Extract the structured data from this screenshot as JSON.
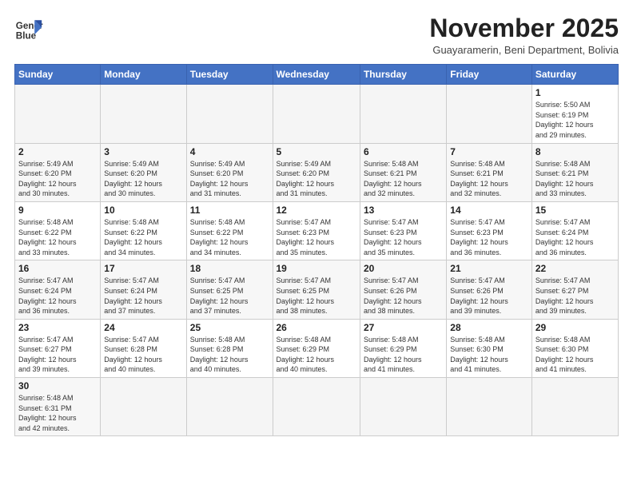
{
  "logo": {
    "line1": "General",
    "line2": "Blue"
  },
  "title": "November 2025",
  "subtitle": "Guayaramerin, Beni Department, Bolivia",
  "headers": [
    "Sunday",
    "Monday",
    "Tuesday",
    "Wednesday",
    "Thursday",
    "Friday",
    "Saturday"
  ],
  "weeks": [
    [
      {
        "day": "",
        "info": ""
      },
      {
        "day": "",
        "info": ""
      },
      {
        "day": "",
        "info": ""
      },
      {
        "day": "",
        "info": ""
      },
      {
        "day": "",
        "info": ""
      },
      {
        "day": "",
        "info": ""
      },
      {
        "day": "1",
        "info": "Sunrise: 5:50 AM\nSunset: 6:19 PM\nDaylight: 12 hours\nand 29 minutes."
      }
    ],
    [
      {
        "day": "2",
        "info": "Sunrise: 5:49 AM\nSunset: 6:20 PM\nDaylight: 12 hours\nand 30 minutes."
      },
      {
        "day": "3",
        "info": "Sunrise: 5:49 AM\nSunset: 6:20 PM\nDaylight: 12 hours\nand 30 minutes."
      },
      {
        "day": "4",
        "info": "Sunrise: 5:49 AM\nSunset: 6:20 PM\nDaylight: 12 hours\nand 31 minutes."
      },
      {
        "day": "5",
        "info": "Sunrise: 5:49 AM\nSunset: 6:20 PM\nDaylight: 12 hours\nand 31 minutes."
      },
      {
        "day": "6",
        "info": "Sunrise: 5:48 AM\nSunset: 6:21 PM\nDaylight: 12 hours\nand 32 minutes."
      },
      {
        "day": "7",
        "info": "Sunrise: 5:48 AM\nSunset: 6:21 PM\nDaylight: 12 hours\nand 32 minutes."
      },
      {
        "day": "8",
        "info": "Sunrise: 5:48 AM\nSunset: 6:21 PM\nDaylight: 12 hours\nand 33 minutes."
      }
    ],
    [
      {
        "day": "9",
        "info": "Sunrise: 5:48 AM\nSunset: 6:22 PM\nDaylight: 12 hours\nand 33 minutes."
      },
      {
        "day": "10",
        "info": "Sunrise: 5:48 AM\nSunset: 6:22 PM\nDaylight: 12 hours\nand 34 minutes."
      },
      {
        "day": "11",
        "info": "Sunrise: 5:48 AM\nSunset: 6:22 PM\nDaylight: 12 hours\nand 34 minutes."
      },
      {
        "day": "12",
        "info": "Sunrise: 5:47 AM\nSunset: 6:23 PM\nDaylight: 12 hours\nand 35 minutes."
      },
      {
        "day": "13",
        "info": "Sunrise: 5:47 AM\nSunset: 6:23 PM\nDaylight: 12 hours\nand 35 minutes."
      },
      {
        "day": "14",
        "info": "Sunrise: 5:47 AM\nSunset: 6:23 PM\nDaylight: 12 hours\nand 36 minutes."
      },
      {
        "day": "15",
        "info": "Sunrise: 5:47 AM\nSunset: 6:24 PM\nDaylight: 12 hours\nand 36 minutes."
      }
    ],
    [
      {
        "day": "16",
        "info": "Sunrise: 5:47 AM\nSunset: 6:24 PM\nDaylight: 12 hours\nand 36 minutes."
      },
      {
        "day": "17",
        "info": "Sunrise: 5:47 AM\nSunset: 6:24 PM\nDaylight: 12 hours\nand 37 minutes."
      },
      {
        "day": "18",
        "info": "Sunrise: 5:47 AM\nSunset: 6:25 PM\nDaylight: 12 hours\nand 37 minutes."
      },
      {
        "day": "19",
        "info": "Sunrise: 5:47 AM\nSunset: 6:25 PM\nDaylight: 12 hours\nand 38 minutes."
      },
      {
        "day": "20",
        "info": "Sunrise: 5:47 AM\nSunset: 6:26 PM\nDaylight: 12 hours\nand 38 minutes."
      },
      {
        "day": "21",
        "info": "Sunrise: 5:47 AM\nSunset: 6:26 PM\nDaylight: 12 hours\nand 39 minutes."
      },
      {
        "day": "22",
        "info": "Sunrise: 5:47 AM\nSunset: 6:27 PM\nDaylight: 12 hours\nand 39 minutes."
      }
    ],
    [
      {
        "day": "23",
        "info": "Sunrise: 5:47 AM\nSunset: 6:27 PM\nDaylight: 12 hours\nand 39 minutes."
      },
      {
        "day": "24",
        "info": "Sunrise: 5:47 AM\nSunset: 6:28 PM\nDaylight: 12 hours\nand 40 minutes."
      },
      {
        "day": "25",
        "info": "Sunrise: 5:48 AM\nSunset: 6:28 PM\nDaylight: 12 hours\nand 40 minutes."
      },
      {
        "day": "26",
        "info": "Sunrise: 5:48 AM\nSunset: 6:29 PM\nDaylight: 12 hours\nand 40 minutes."
      },
      {
        "day": "27",
        "info": "Sunrise: 5:48 AM\nSunset: 6:29 PM\nDaylight: 12 hours\nand 41 minutes."
      },
      {
        "day": "28",
        "info": "Sunrise: 5:48 AM\nSunset: 6:30 PM\nDaylight: 12 hours\nand 41 minutes."
      },
      {
        "day": "29",
        "info": "Sunrise: 5:48 AM\nSunset: 6:30 PM\nDaylight: 12 hours\nand 41 minutes."
      }
    ],
    [
      {
        "day": "30",
        "info": "Sunrise: 5:48 AM\nSunset: 6:31 PM\nDaylight: 12 hours\nand 42 minutes."
      },
      {
        "day": "",
        "info": ""
      },
      {
        "day": "",
        "info": ""
      },
      {
        "day": "",
        "info": ""
      },
      {
        "day": "",
        "info": ""
      },
      {
        "day": "",
        "info": ""
      },
      {
        "day": "",
        "info": ""
      }
    ]
  ]
}
